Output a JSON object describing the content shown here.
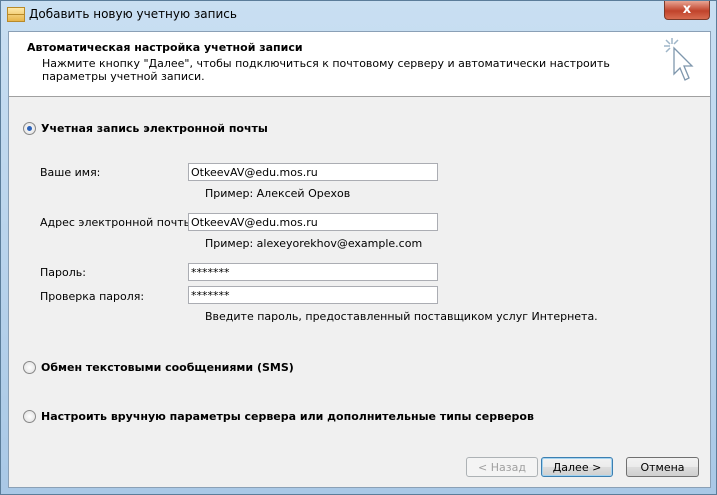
{
  "window": {
    "title": "Добавить новую учетную запись",
    "close_label": "x"
  },
  "header": {
    "title": "Автоматическая настройка учетной записи",
    "description": "Нажмите кнопку \"Далее\", чтобы подключиться к почтовому серверу и автоматически настроить параметры учетной записи."
  },
  "options": {
    "email_account": "Учетная запись электронной почты",
    "sms": "Обмен текстовыми сообщениями (SMS)",
    "manual": "Настроить вручную параметры сервера или дополнительные типы серверов"
  },
  "form": {
    "name_label": "Ваше имя:",
    "name_value": "OtkeevAV@edu.mos.ru",
    "name_hint": "Пример: Алексей Орехов",
    "email_label": "Адрес электронной почты:",
    "email_value": "OtkeevAV@edu.mos.ru",
    "email_hint": "Пример: alexeyorekhov@example.com",
    "password_label": "Пароль:",
    "password_value": "*******",
    "confirm_label": "Проверка пароля:",
    "confirm_value": "*******",
    "password_hint": "Введите пароль, предоставленный поставщиком услуг Интернета."
  },
  "buttons": {
    "back": "< Назад",
    "next": "Далее >",
    "cancel": "Отмена"
  }
}
